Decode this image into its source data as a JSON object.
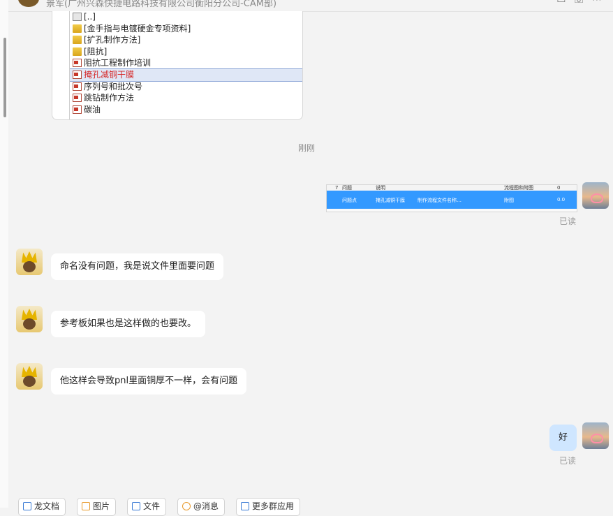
{
  "header": {
    "title": "景军(广州兴森快捷电路科技有限公司衡阳分公司-CAM部)",
    "icons": [
      "video-icon",
      "phone-icon",
      "more-icon"
    ]
  },
  "file_browser": {
    "items": [
      {
        "label": "[..]",
        "icon": "up-folder-icon",
        "selected": false
      },
      {
        "label": "[金手指与电镀硬金专项资料]",
        "icon": "folder-icon",
        "selected": false
      },
      {
        "label": "[扩孔制作方法]",
        "icon": "folder-icon",
        "selected": false
      },
      {
        "label": "[阻抗]",
        "icon": "folder-icon",
        "selected": false
      },
      {
        "label": "阻抗工程制作培训",
        "icon": "document-icon",
        "selected": false
      },
      {
        "label": "掩孔减铜干膜",
        "icon": "document-icon",
        "selected": true
      },
      {
        "label": "序列号和批次号",
        "icon": "document-icon",
        "selected": false
      },
      {
        "label": "跳钻制作方法",
        "icon": "document-icon",
        "selected": false
      },
      {
        "label": "碳油",
        "icon": "document-icon",
        "selected": false
      }
    ]
  },
  "timestamp": "刚刚",
  "screenshot_message": {
    "read_status": "已读",
    "header_cells": [
      "7",
      "问题",
      "说明",
      "流程图和附图",
      "0"
    ],
    "row_cells": [
      "问题点",
      "掩孔减铜干膜",
      "制作流程文件名称…",
      "附图",
      "0.0"
    ]
  },
  "messages": [
    {
      "from": "other",
      "text": "命名没有问题，我是说文件里面要问题"
    },
    {
      "from": "other",
      "text": "参考板如果也是这样做的也要改。"
    },
    {
      "from": "other",
      "text": "他这样会导致pnl里面铜厚不一样，会有问题"
    },
    {
      "from": "me",
      "text": "好",
      "read_status": "已读"
    }
  ],
  "toolbar": {
    "buttons": [
      {
        "label": "龙文档",
        "icon": "document-icon"
      },
      {
        "label": "图片",
        "icon": "image-icon"
      },
      {
        "label": "文件",
        "icon": "folder-icon"
      },
      {
        "label": "@消息",
        "icon": "at-icon"
      },
      {
        "label": "更多群应用",
        "icon": "apps-icon"
      }
    ]
  },
  "colors": {
    "background": "#f3f3f3",
    "my_bubble": "#cfe6ff",
    "selection_highlight": "#3399ff",
    "selected_file_text": "#d62828"
  }
}
